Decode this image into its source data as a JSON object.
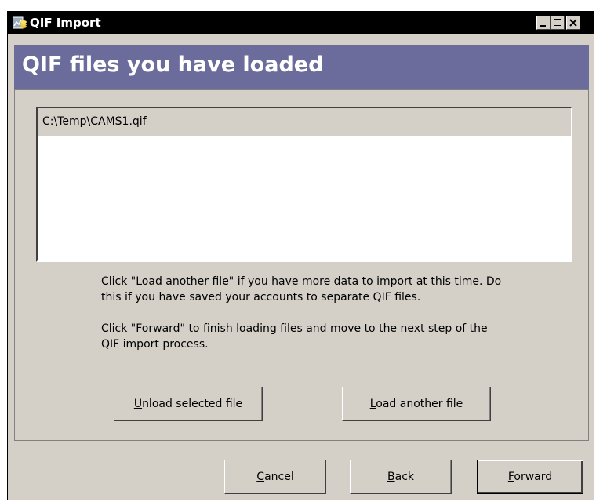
{
  "window": {
    "title": "QIF Import",
    "title_icon": "qif-app-icon",
    "controls": [
      "minimize-icon",
      "maximize-icon",
      "close-icon"
    ]
  },
  "banner": {
    "heading": "QIF files you have loaded"
  },
  "file_list": {
    "items": [
      "C:\\Temp\\CAMS1.qif"
    ],
    "selected_index": 0
  },
  "instructions": {
    "paragraph1": "Click \"Load another file\" if you have more data to import at this time. Do this if you have saved your accounts to separate QIF files.",
    "paragraph2": "Click \"Forward\" to finish loading files and move to the next step of the QIF import process."
  },
  "buttons": {
    "unload": {
      "mnemonic": "U",
      "rest": "nload selected file"
    },
    "load": {
      "mnemonic": "L",
      "rest": "oad another file"
    },
    "cancel": {
      "mnemonic": "C",
      "rest": "ancel"
    },
    "back": {
      "mnemonic": "B",
      "rest": "ack"
    },
    "forward": {
      "mnemonic": "F",
      "rest": "orward"
    }
  }
}
